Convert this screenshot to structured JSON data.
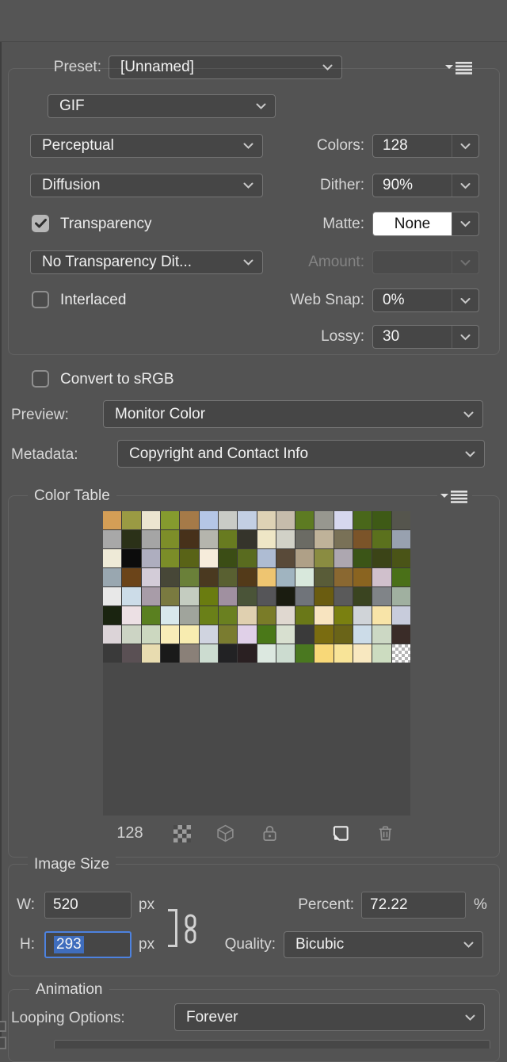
{
  "preset": {
    "label": "Preset:",
    "value": "[Unnamed]"
  },
  "format": {
    "value": "GIF"
  },
  "settings": {
    "reduction": "Perceptual",
    "colors_label": "Colors:",
    "colors": "128",
    "dither_method": "Diffusion",
    "dither_label": "Dither:",
    "dither": "90%",
    "transparency_label": "Transparency",
    "matte_label": "Matte:",
    "matte": "None",
    "transparency_dither": "No Transparency Dit...",
    "amount_label": "Amount:",
    "amount": "",
    "interlaced_label": "Interlaced",
    "websnap_label": "Web Snap:",
    "websnap": "0%",
    "lossy_label": "Lossy:",
    "lossy": "30"
  },
  "checks": {
    "transparency": true,
    "interlaced": false,
    "convert_srgb": false
  },
  "convert_label": "Convert to sRGB",
  "preview": {
    "label": "Preview:",
    "value": "Monitor Color"
  },
  "metadata": {
    "label": "Metadata:",
    "value": "Copyright and Contact Info"
  },
  "color_table": {
    "title": "Color Table",
    "count": "128",
    "icons": [
      "transparency-map-icon",
      "3d-cube-icon",
      "lock-color-icon",
      "new-color-icon",
      "delete-color-icon"
    ],
    "swatches": [
      "#d49e56",
      "#9a9a43",
      "#ece5d0",
      "#859b2e",
      "#a57a48",
      "#b5c6e6",
      "#c9cbc6",
      "#c3cfe3",
      "#ded2b5",
      "#c6bcab",
      "#5d7b22",
      "#97978f",
      "#d6d7ee",
      "#49671a",
      "#3e5a16",
      "#55554d",
      "#a8a8a8",
      "#2b3118",
      "#a5a5a5",
      "#7d8e29",
      "#47311a",
      "#b5b5ad",
      "#687b20",
      "#35342b",
      "#eee6c6",
      "#d1d1c7",
      "#6b6b64",
      "#bfb299",
      "#797157",
      "#7b5429",
      "#5b711d",
      "#98a1af",
      "#eeead7",
      "#0c0c0c",
      "#aeaebf",
      "#7b8d28",
      "#596317",
      "#f6ecdb",
      "#3b4d15",
      "#596b1f",
      "#aebcd3",
      "#594a39",
      "#afa087",
      "#8a8c41",
      "#ada7b0",
      "#3b5517",
      "#3b4417",
      "#4a5417",
      "#99a7b0",
      "#6b4419",
      "#d3ccd8",
      "#474737",
      "#6a8039",
      "#4a3920",
      "#596031",
      "#533a19",
      "#eec571",
      "#a0b4c0",
      "#d8e8dc",
      "#595c38",
      "#8a6831",
      "#8a6420",
      "#d0c0cc",
      "#4a7018",
      "#e8e8e8",
      "#ccdce8",
      "#a89ca8",
      "#7a7a40",
      "#c4ccc0",
      "#6a7c10",
      "#a090a0",
      "#4a5438",
      "#555558",
      "#1a1c10",
      "#70747a",
      "#6a5c10",
      "#5a5a5a",
      "#3a4420",
      "#808488",
      "#a0b0a0",
      "#1a2410",
      "#ece0e4",
      "#5a8020",
      "#d8e8ec",
      "#a0a49c",
      "#6a8018",
      "#6a8020",
      "#e0d0b0",
      "#7a7c28",
      "#e0d8d0",
      "#6a7818",
      "#f8e4c0",
      "#7a8010",
      "#d0d4d8",
      "#f8e4a8",
      "#c8ccdc",
      "#dcd4d8",
      "#ccd4c4",
      "#ccd8c0",
      "#f8ecb8",
      "#f8ecb0",
      "#d0d4e0",
      "#7a7c30",
      "#e0d0e8",
      "#4a7818",
      "#d8e0d0",
      "#3a3a3a",
      "#7a6c10",
      "#6a6418",
      "#ccdce8",
      "#ccd8c4",
      "#3a2c28",
      "#3a3a3a",
      "#5a5054",
      "#e8dcb0",
      "#1a1a1a",
      "#8a8078",
      "#ccdcd0",
      "#222224",
      "#2a2022",
      "#dce8e0",
      "#ccdcd0",
      "#4a7820",
      "#f8d878",
      "#f8e498",
      "#f8e8c0",
      "#ccdcc0",
      "checker"
    ]
  },
  "image_size": {
    "title": "Image Size",
    "w_label": "W:",
    "w": "520",
    "w_unit": "px",
    "h_label": "H:",
    "h": "293",
    "h_unit": "px",
    "percent_label": "Percent:",
    "percent": "72.22",
    "percent_unit": "%",
    "quality_label": "Quality:",
    "quality": "Bicubic"
  },
  "animation": {
    "title": "Animation",
    "looping_label": "Looping Options:",
    "looping": "Forever"
  },
  "theme": {
    "panel_bg": "#535353",
    "control_bg": "#464646",
    "focus_blue": "#4d82e0",
    "selection_blue": "#3f6dbd",
    "matte_field_bg": "#ffffff"
  }
}
